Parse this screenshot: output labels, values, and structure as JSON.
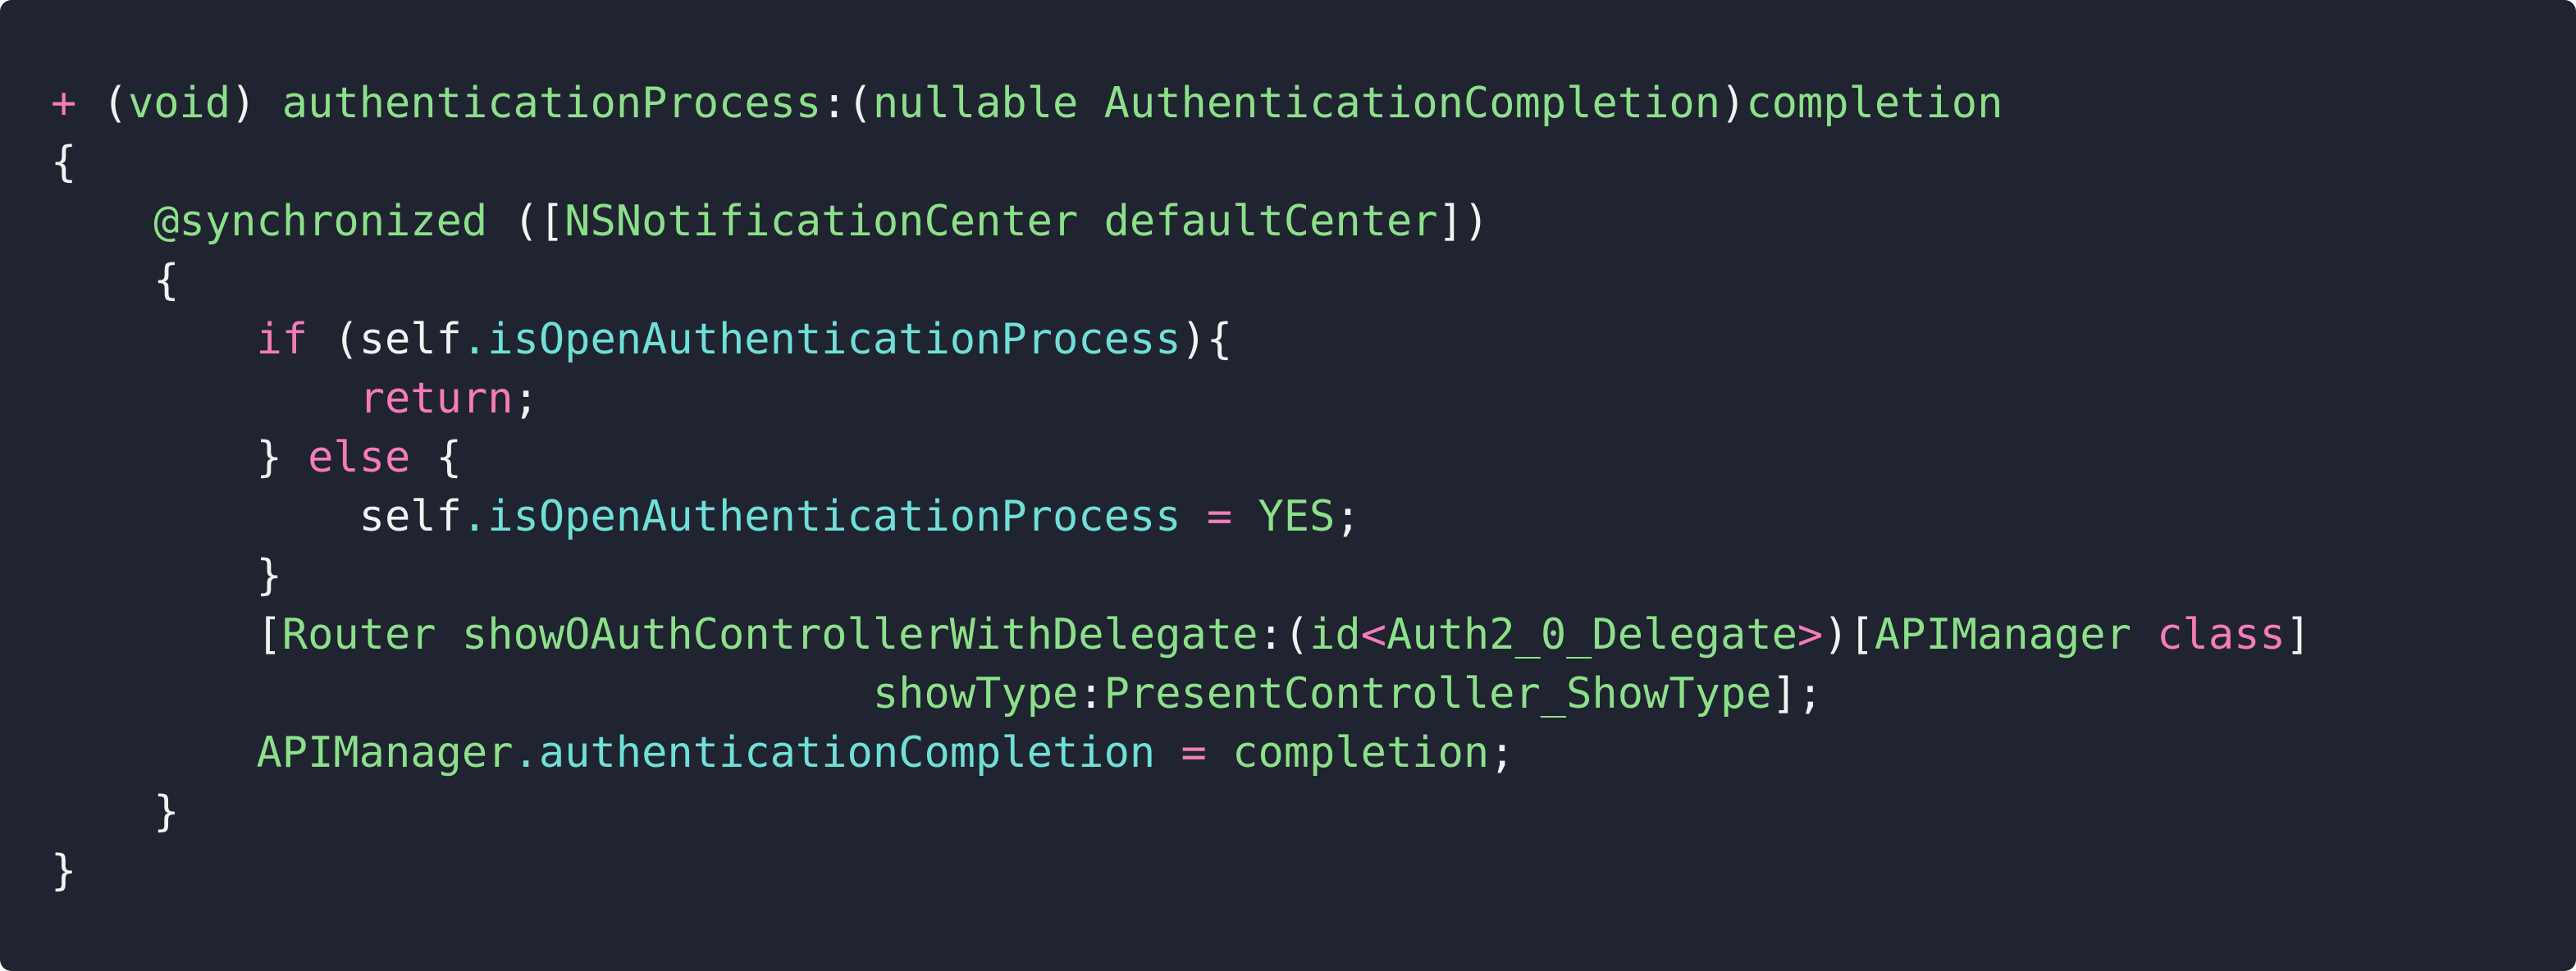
{
  "colors": {
    "background": "#1f2430",
    "plain": "#f2f2f2",
    "keyword": "#f47cb8",
    "identifier": "#8de08a",
    "property": "#6fe0d8"
  },
  "code_lines": [
    [
      {
        "text": "+",
        "kind": "keyword"
      },
      {
        "text": " (",
        "kind": "plain"
      },
      {
        "text": "void",
        "kind": "identifier"
      },
      {
        "text": ") ",
        "kind": "plain"
      },
      {
        "text": "authenticationProcess",
        "kind": "identifier"
      },
      {
        "text": ":(",
        "kind": "plain"
      },
      {
        "text": "nullable",
        "kind": "identifier"
      },
      {
        "text": " ",
        "kind": "plain"
      },
      {
        "text": "AuthenticationCompletion",
        "kind": "identifier"
      },
      {
        "text": ")",
        "kind": "plain"
      },
      {
        "text": "completion",
        "kind": "identifier"
      }
    ],
    [
      {
        "text": "{",
        "kind": "plain"
      }
    ],
    [
      {
        "text": "    ",
        "kind": "plain"
      },
      {
        "text": "@synchronized",
        "kind": "identifier"
      },
      {
        "text": " ([",
        "kind": "plain"
      },
      {
        "text": "NSNotificationCenter",
        "kind": "identifier"
      },
      {
        "text": " ",
        "kind": "plain"
      },
      {
        "text": "defaultCenter",
        "kind": "identifier"
      },
      {
        "text": "])",
        "kind": "plain"
      }
    ],
    [
      {
        "text": "    {",
        "kind": "plain"
      }
    ],
    [
      {
        "text": "        ",
        "kind": "plain"
      },
      {
        "text": "if",
        "kind": "keyword"
      },
      {
        "text": " (self",
        "kind": "plain"
      },
      {
        "text": ".isOpenAuthenticationProcess",
        "kind": "property"
      },
      {
        "text": "){",
        "kind": "plain"
      }
    ],
    [
      {
        "text": "            ",
        "kind": "plain"
      },
      {
        "text": "return",
        "kind": "keyword"
      },
      {
        "text": ";",
        "kind": "plain"
      }
    ],
    [
      {
        "text": "        } ",
        "kind": "plain"
      },
      {
        "text": "else",
        "kind": "keyword"
      },
      {
        "text": " {",
        "kind": "plain"
      }
    ],
    [
      {
        "text": "            self",
        "kind": "plain"
      },
      {
        "text": ".isOpenAuthenticationProcess",
        "kind": "property"
      },
      {
        "text": " ",
        "kind": "plain"
      },
      {
        "text": "=",
        "kind": "keyword"
      },
      {
        "text": " ",
        "kind": "plain"
      },
      {
        "text": "YES",
        "kind": "identifier"
      },
      {
        "text": ";",
        "kind": "plain"
      }
    ],
    [
      {
        "text": "        }",
        "kind": "plain"
      }
    ],
    [
      {
        "text": "        [",
        "kind": "plain"
      },
      {
        "text": "Router",
        "kind": "identifier"
      },
      {
        "text": " ",
        "kind": "plain"
      },
      {
        "text": "showOAuthControllerWithDelegate",
        "kind": "identifier"
      },
      {
        "text": ":(",
        "kind": "plain"
      },
      {
        "text": "id",
        "kind": "identifier"
      },
      {
        "text": "<",
        "kind": "keyword"
      },
      {
        "text": "Auth2_0_Delegate",
        "kind": "identifier"
      },
      {
        "text": ">",
        "kind": "keyword"
      },
      {
        "text": ")[",
        "kind": "plain"
      },
      {
        "text": "APIManager",
        "kind": "identifier"
      },
      {
        "text": " ",
        "kind": "plain"
      },
      {
        "text": "class",
        "kind": "keyword"
      },
      {
        "text": "]",
        "kind": "plain"
      }
    ],
    [
      {
        "text": "                                ",
        "kind": "plain"
      },
      {
        "text": "showType",
        "kind": "identifier"
      },
      {
        "text": ":",
        "kind": "plain"
      },
      {
        "text": "PresentController_ShowType",
        "kind": "identifier"
      },
      {
        "text": "];",
        "kind": "plain"
      }
    ],
    [
      {
        "text": "        ",
        "kind": "plain"
      },
      {
        "text": "APIManager",
        "kind": "identifier"
      },
      {
        "text": ".authenticationCompletion",
        "kind": "property"
      },
      {
        "text": " ",
        "kind": "plain"
      },
      {
        "text": "=",
        "kind": "keyword"
      },
      {
        "text": " ",
        "kind": "plain"
      },
      {
        "text": "completion",
        "kind": "identifier"
      },
      {
        "text": ";",
        "kind": "plain"
      }
    ],
    [
      {
        "text": "    }",
        "kind": "plain"
      }
    ],
    [
      {
        "text": "}",
        "kind": "plain"
      }
    ]
  ]
}
